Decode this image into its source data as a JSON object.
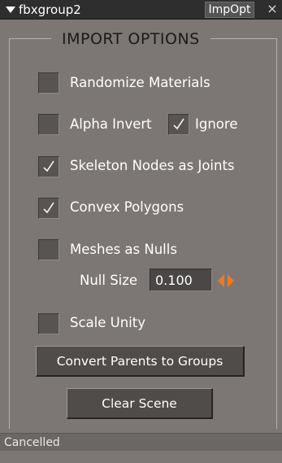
{
  "window": {
    "title": "fbxgroup2",
    "tab_label": "ImpOpt",
    "close_glyph": "×"
  },
  "group": {
    "title": "IMPORT OPTIONS"
  },
  "options": {
    "randomize_materials": {
      "label": "Randomize Materials",
      "checked": false
    },
    "alpha_invert": {
      "label": "Alpha Invert",
      "checked": false
    },
    "ignore": {
      "label": "Ignore",
      "checked": true
    },
    "skeleton_nodes_as_joints": {
      "label": "Skeleton Nodes as Joints",
      "checked": true
    },
    "convex_polygons": {
      "label": "Convex Polygons",
      "checked": true
    },
    "meshes_as_nulls": {
      "label": "Meshes as Nulls",
      "checked": false
    },
    "scale_unity": {
      "label": "Scale Unity",
      "checked": false
    }
  },
  "null_size": {
    "label": "Null Size",
    "value": "0.100"
  },
  "buttons": {
    "convert_parents": "Convert Parents to Groups",
    "clear_scene": "Clear Scene"
  },
  "status": {
    "text": "Cancelled"
  },
  "colors": {
    "background": "#7c7774",
    "titlebar": "#2e2e2e",
    "spinner_accent": "#f07a1e"
  }
}
